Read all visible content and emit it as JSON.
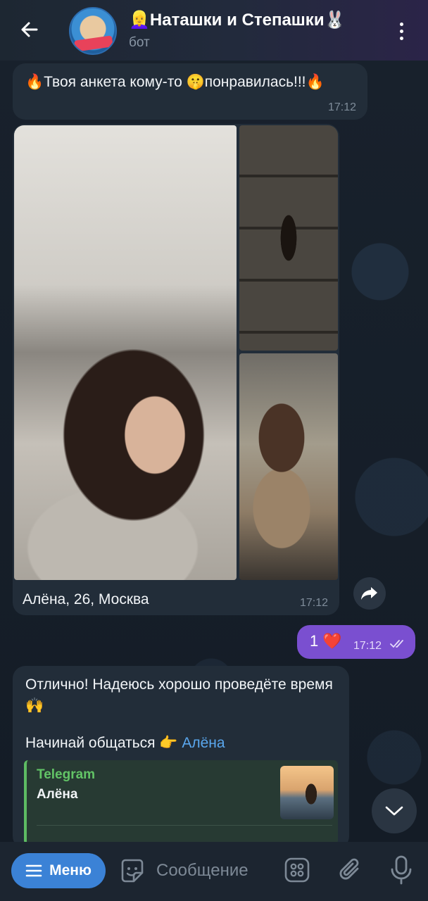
{
  "header": {
    "title": "👱‍♀️Наташки и Степашки🐰",
    "subtitle": "бот"
  },
  "messages": {
    "first": {
      "text": "🔥Твоя анкета кому-то 🤫понравилась!!!🔥",
      "time": "17:12"
    },
    "album": {
      "caption": "Алёна, 26, Москва",
      "time": "17:12"
    },
    "outgoing": {
      "text": "1 ❤️",
      "time": "17:12"
    },
    "reply": {
      "line1": "Отлично! Надеюсь хорошо проведёте время 🙌",
      "line2_prefix": "Начинай общаться 👉 ",
      "line2_link": "Алёна",
      "preview_site": "Telegram",
      "preview_name": "Алёна"
    }
  },
  "input_bar": {
    "menu_label": "Меню",
    "placeholder": "Сообщение"
  },
  "colors": {
    "header_bg": "#222a3c",
    "incoming_bubble": "#222d39",
    "outgoing_bubble": "#7a4fd0",
    "menu_button": "#3b82d6",
    "link": "#5aa7ee",
    "preview_accent": "#62c466"
  },
  "icons": [
    "back-arrow-icon",
    "more-vertical-icon",
    "share-icon",
    "double-check-icon",
    "chevron-down-icon",
    "menu-icon",
    "sticker-icon",
    "apps-icon",
    "attach-icon",
    "mic-icon"
  ]
}
